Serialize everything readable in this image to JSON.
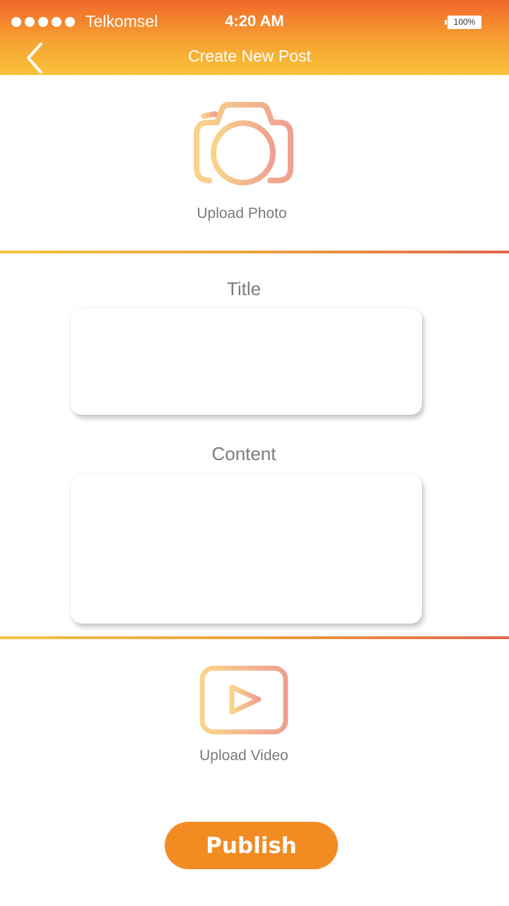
{
  "status_bar": {
    "carrier": "Telkomsel",
    "time": "4:20 AM",
    "battery": "100%",
    "signal_dots": 5
  },
  "header": {
    "back_icon": "chevron-left-icon",
    "title": "Create New Post"
  },
  "upload_photo": {
    "icon": "camera-icon",
    "label": "Upload Photo"
  },
  "form": {
    "title_label": "Title",
    "title_value": "",
    "content_label": "Content",
    "content_value": ""
  },
  "upload_video": {
    "icon": "video-play-icon",
    "label": "Upload Video"
  },
  "publish_label": "Publish",
  "colors": {
    "header_top": "#f2672a",
    "header_bottom": "#f9c33a",
    "publish_button": "#f28c22",
    "icon_gradient_start": "#f9d48a",
    "icon_gradient_end": "#efa090",
    "label_gray": "#7b7b7b"
  }
}
